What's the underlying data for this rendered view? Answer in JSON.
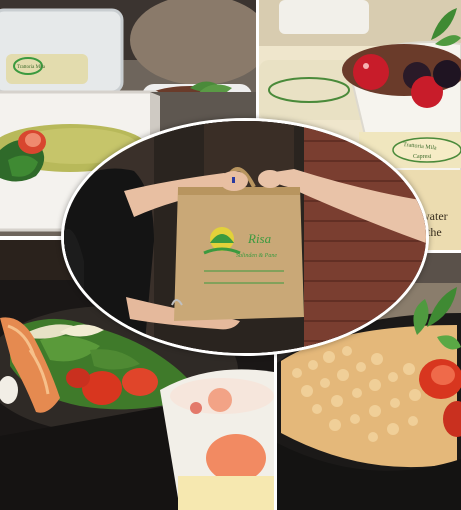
{
  "photo_collage": {
    "top_left_container_label": "Trattoria Mila",
    "top_right_cup_label": "Trattoria Mila",
    "top_right_cup_sublabel": "Capresi",
    "top_right_side_text_line1": "water",
    "top_right_side_text_line2": "the",
    "bag_brand": "Risa",
    "bag_tagline": "Salinden & Pane",
    "colors": {
      "bag": "#c9a877",
      "bag_print": "#3b9a3f",
      "bag_print_yellow": "#e2d13a",
      "brick": "#8a4a3a",
      "dessert": "#6a3b2a",
      "salad_green": "#3f7a2a",
      "tomato": "#d83a25"
    }
  }
}
